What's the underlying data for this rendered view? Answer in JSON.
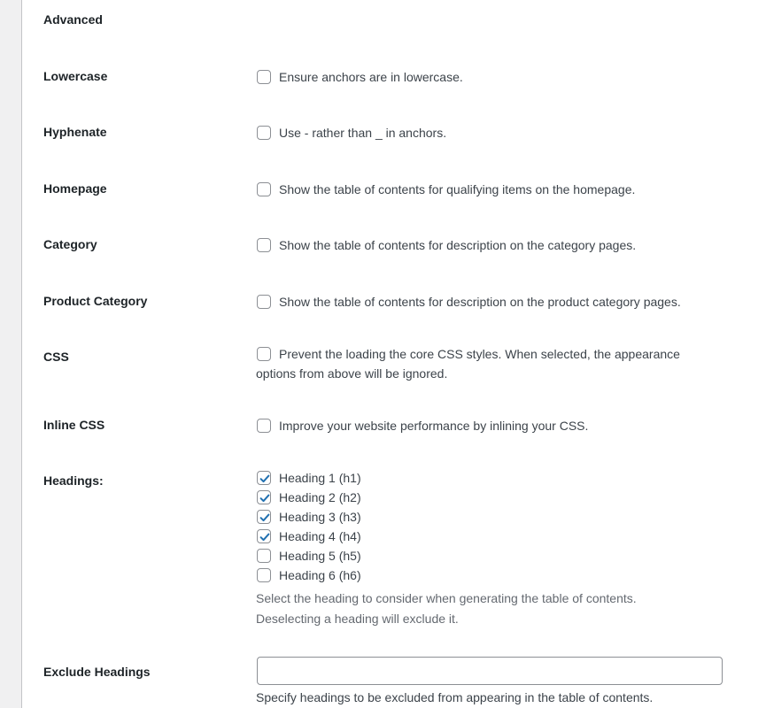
{
  "section_title": "Advanced",
  "settings": {
    "lowercase": {
      "label": "Lowercase",
      "description": "Ensure anchors are in lowercase.",
      "checked": false
    },
    "hyphenate": {
      "label": "Hyphenate",
      "description": "Use - rather than _ in anchors.",
      "checked": false
    },
    "homepage": {
      "label": "Homepage",
      "description": "Show the table of contents for qualifying items on the homepage.",
      "checked": false
    },
    "category": {
      "label": "Category",
      "description": "Show the table of contents for description on the category pages.",
      "checked": false
    },
    "product_category": {
      "label": "Product Category",
      "description": "Show the table of contents for description on the product category pages.",
      "checked": false
    },
    "css": {
      "label": "CSS",
      "description": "Prevent the loading the core CSS styles. When selected, the appearance options from above will be ignored.",
      "checked": false
    },
    "inline_css": {
      "label": "Inline CSS",
      "description": "Improve your website performance by inlining your CSS.",
      "checked": false
    }
  },
  "headings": {
    "label": "Headings:",
    "items": [
      {
        "label": "Heading 1 (h1)",
        "checked": true
      },
      {
        "label": "Heading 2 (h2)",
        "checked": true
      },
      {
        "label": "Heading 3 (h3)",
        "checked": true
      },
      {
        "label": "Heading 4 (h4)",
        "checked": true
      },
      {
        "label": "Heading 5 (h5)",
        "checked": false
      },
      {
        "label": "Heading 6 (h6)",
        "checked": false
      }
    ],
    "help_line1": "Select the heading to consider when generating the table of contents.",
    "help_line2": "Deselecting a heading will exclude it."
  },
  "exclude_headings": {
    "label": "Exclude Headings",
    "value": "",
    "help": "Specify headings to be excluded from appearing in the table of contents."
  },
  "colors": {
    "check": "#2271b1",
    "border": "#8c8f94",
    "text": "#1d2327",
    "muted": "#646970"
  },
  "icons": {
    "checkmark": "checkmark-icon"
  }
}
